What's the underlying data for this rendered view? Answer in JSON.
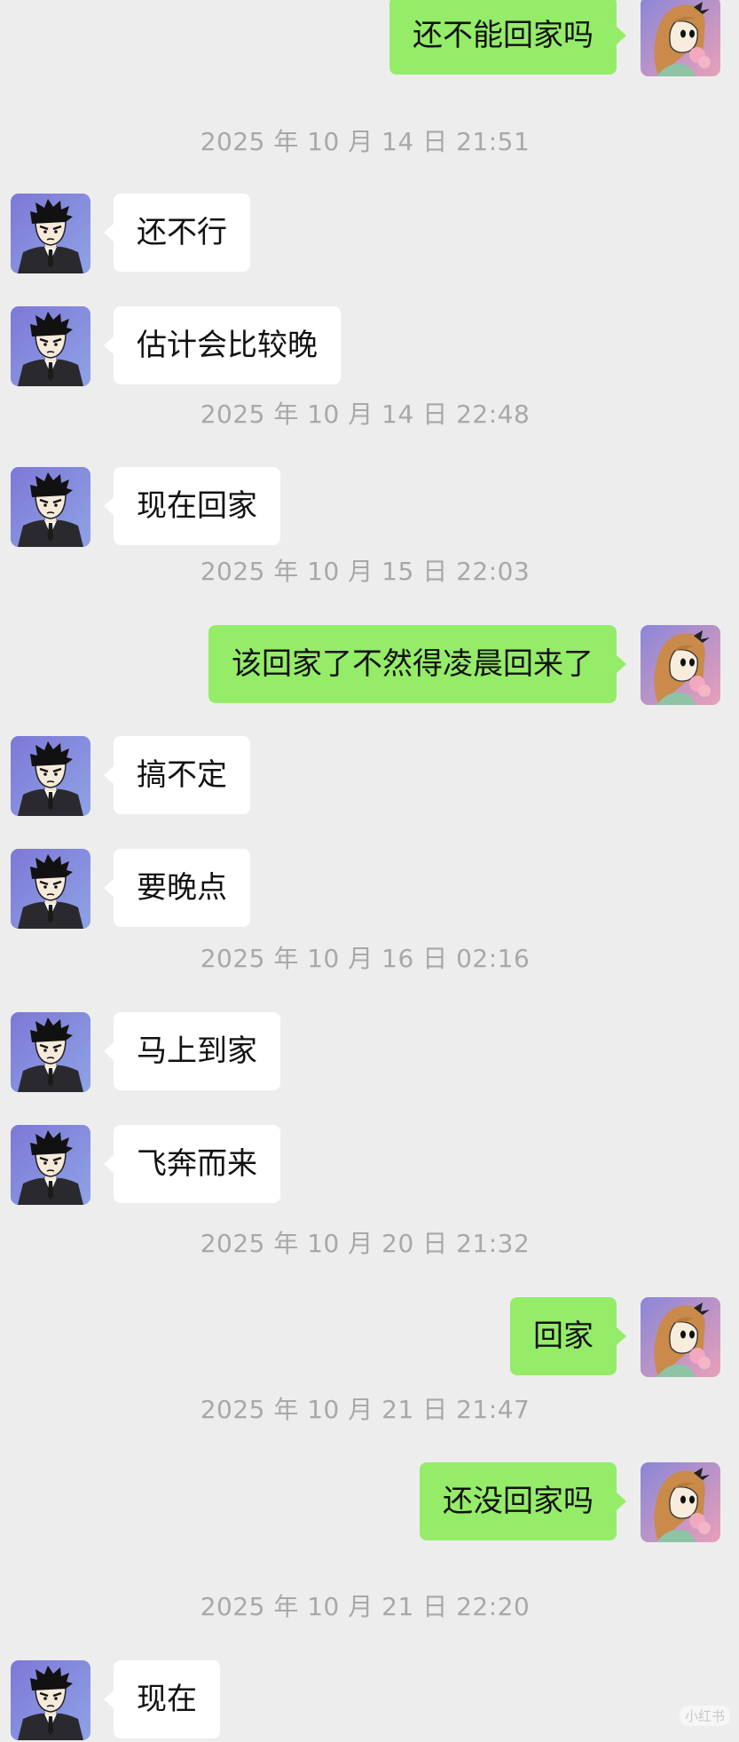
{
  "chat": {
    "timestamps": [
      "2025 年 10 月 14 日  21:51",
      "2025 年 10 月 14 日  22:48",
      "2025 年 10 月 15 日  22:03",
      "2025 年 10 月 16 日  02:16",
      "2025 年 10 月 20 日  21:32",
      "2025 年 10 月 21 日  21:47",
      "2025 年 10 月 21 日  22:20"
    ],
    "messages": [
      {
        "sender": "me",
        "text": "还不能回家吗"
      },
      {
        "sender": "contact",
        "text": "还不行"
      },
      {
        "sender": "contact",
        "text": "估计会比较晚"
      },
      {
        "sender": "contact",
        "text": "现在回家"
      },
      {
        "sender": "me",
        "text": "该回家了不然得凌晨回来了"
      },
      {
        "sender": "contact",
        "text": "搞不定"
      },
      {
        "sender": "contact",
        "text": "要晚点"
      },
      {
        "sender": "contact",
        "text": "马上到家"
      },
      {
        "sender": "contact",
        "text": "飞奔而来"
      },
      {
        "sender": "me",
        "text": "回家"
      },
      {
        "sender": "me",
        "text": "还没回家吗"
      },
      {
        "sender": "contact",
        "text": "现在"
      }
    ]
  },
  "avatars": {
    "me": "girl-cartoon-avatar-icon",
    "contact": "man-in-suit-cartoon-avatar-icon"
  },
  "colors": {
    "background": "#ededed",
    "outgoing_bubble": "#95ec69",
    "incoming_bubble": "#ffffff",
    "timestamp_text": "#a8a8a8"
  },
  "watermark": "小红书"
}
